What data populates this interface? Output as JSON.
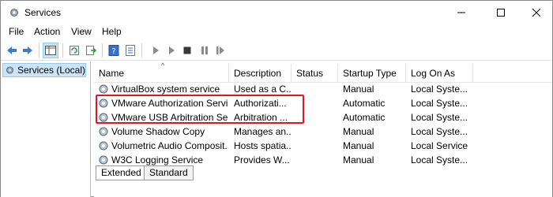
{
  "window": {
    "title": "Services",
    "icon": "gear-icon"
  },
  "menu": [
    {
      "label": "File"
    },
    {
      "label": "Action"
    },
    {
      "label": "View"
    },
    {
      "label": "Help"
    }
  ],
  "toolbar": {
    "buttons": [
      "back-arrow-icon",
      "forward-arrow-icon",
      "console-tree-icon",
      "refresh-icon",
      "export-icon",
      "help-icon",
      "properties-icon",
      "play-icon",
      "play-alt-icon",
      "stop-icon",
      "pause-icon",
      "restart-icon"
    ]
  },
  "tree": {
    "selected": "Services (Local)"
  },
  "columns": [
    {
      "label": "Name"
    },
    {
      "label": "Description"
    },
    {
      "label": "Status"
    },
    {
      "label": "Startup Type"
    },
    {
      "label": "Log On As"
    }
  ],
  "rows": [
    {
      "name": "VirtualBox system service",
      "description": "Used as a C...",
      "status": "",
      "startup": "Manual",
      "logon": "Local Syste..."
    },
    {
      "name": "VMware Authorization Servi...",
      "description": "Authorizati...",
      "status": "",
      "startup": "Automatic",
      "logon": "Local Syste..."
    },
    {
      "name": "VMware USB Arbitration Ser...",
      "description": "Arbitration ...",
      "status": "",
      "startup": "Automatic",
      "logon": "Local Syste..."
    },
    {
      "name": "Volume Shadow Copy",
      "description": "Manages an...",
      "status": "",
      "startup": "Manual",
      "logon": "Local Syste..."
    },
    {
      "name": "Volumetric Audio Composit...",
      "description": "Hosts spatia...",
      "status": "",
      "startup": "Manual",
      "logon": "Local Service"
    },
    {
      "name": "W3C Logging Service",
      "description": "Provides W...",
      "status": "",
      "startup": "Manual",
      "logon": "Local Syste..."
    }
  ],
  "tabs": [
    {
      "label": "Extended"
    },
    {
      "label": "Standard"
    }
  ],
  "highlight_color": "#e81123",
  "selection_color": "#cce4f7"
}
